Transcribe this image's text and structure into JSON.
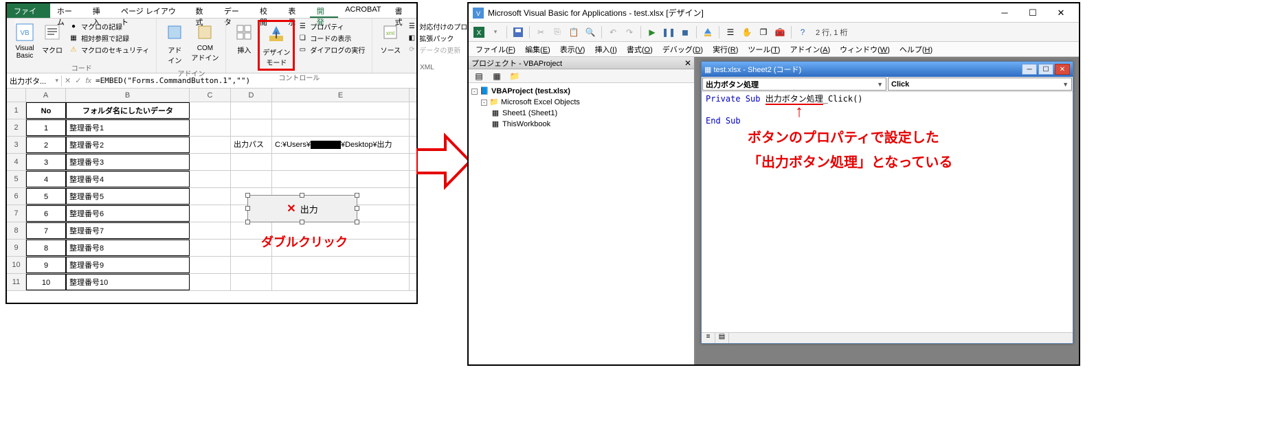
{
  "excel": {
    "tabs": [
      "ファイル",
      "ホーム",
      "挿入",
      "ページ レイアウト",
      "数式",
      "データ",
      "校閲",
      "表示",
      "開発",
      "ACROBAT",
      "書式"
    ],
    "active_tab": "ファイル",
    "selected_tab": "開発",
    "ribbon": {
      "code_group": {
        "label": "コード",
        "vb_btn": "Visual Basic",
        "macro_btn": "マクロ",
        "record": "マクロの記録",
        "relative": "相対参照で記録",
        "security": "マクロのセキュリティ"
      },
      "addin_group": {
        "label": "アドイン",
        "addin": "アド\nイン",
        "com": "COM\nアドイン"
      },
      "control_group": {
        "label": "コントロール",
        "insert": "挿入",
        "design": "デザイン\nモード",
        "props": "プロパティ",
        "viewcode": "コードの表示",
        "rundlg": "ダイアログの実行"
      },
      "xml_group": {
        "label": "XML",
        "source": "ソース",
        "mapprops": "対応付けのプロパ",
        "expand": "拡張パック",
        "refresh": "データの更新"
      }
    },
    "name_box": "出力ボタ...",
    "formula": "=EMBED(\"Forms.CommandButton.1\",\"\")",
    "columns": [
      "A",
      "B",
      "C",
      "D",
      "E"
    ],
    "headers": {
      "no": "No",
      "folder": "フォルダ名にしたいデータ"
    },
    "rows": [
      {
        "no": "1",
        "b": "整理番号1"
      },
      {
        "no": "2",
        "b": "整理番号2"
      },
      {
        "no": "3",
        "b": "整理番号3"
      },
      {
        "no": "4",
        "b": "整理番号4"
      },
      {
        "no": "5",
        "b": "整理番号5"
      },
      {
        "no": "6",
        "b": "整理番号6"
      },
      {
        "no": "7",
        "b": "整理番号7"
      },
      {
        "no": "8",
        "b": "整理番号8"
      },
      {
        "no": "9",
        "b": "整理番号9"
      },
      {
        "no": "10",
        "b": "整理番号10"
      }
    ],
    "path_label": "出力パス",
    "path_prefix": "C:¥Users¥",
    "path_suffix": "¥Desktop¥出力",
    "button_caption": "出力",
    "dblclick_label": "ダブルクリック"
  },
  "vbe": {
    "title": "Microsoft Visual Basic for Applications - test.xlsx [デザイン]",
    "toolbar_status": "2 行, 1 桁",
    "menus": [
      {
        "t": "ファイル",
        "u": "F"
      },
      {
        "t": "編集",
        "u": "E"
      },
      {
        "t": "表示",
        "u": "V"
      },
      {
        "t": "挿入",
        "u": "I"
      },
      {
        "t": "書式",
        "u": "O"
      },
      {
        "t": "デバッグ",
        "u": "D"
      },
      {
        "t": "実行",
        "u": "R"
      },
      {
        "t": "ツール",
        "u": "T"
      },
      {
        "t": "アドイン",
        "u": "A"
      },
      {
        "t": "ウィンドウ",
        "u": "W"
      },
      {
        "t": "ヘルプ",
        "u": "H"
      }
    ],
    "project_pane_title": "プロジェクト - VBAProject",
    "tree": {
      "root": "VBAProject (test.xlsx)",
      "folder": "Microsoft Excel Objects",
      "sheet1": "Sheet1 (Sheet1)",
      "thiswb": "ThisWorkbook"
    },
    "code_window": {
      "title": "test.xlsx - Sheet2 (コード)",
      "dd_left": "出力ボタン処理",
      "dd_right": "Click",
      "line1_a": "Private Sub ",
      "line1_b": "出力ボタン処理",
      "line1_c": "_Click()",
      "line2": "",
      "line3": "End Sub"
    },
    "annotation_line1": "ボタンのプロパティで設定した",
    "annotation_line2": "「出力ボタン処理」となっている"
  }
}
